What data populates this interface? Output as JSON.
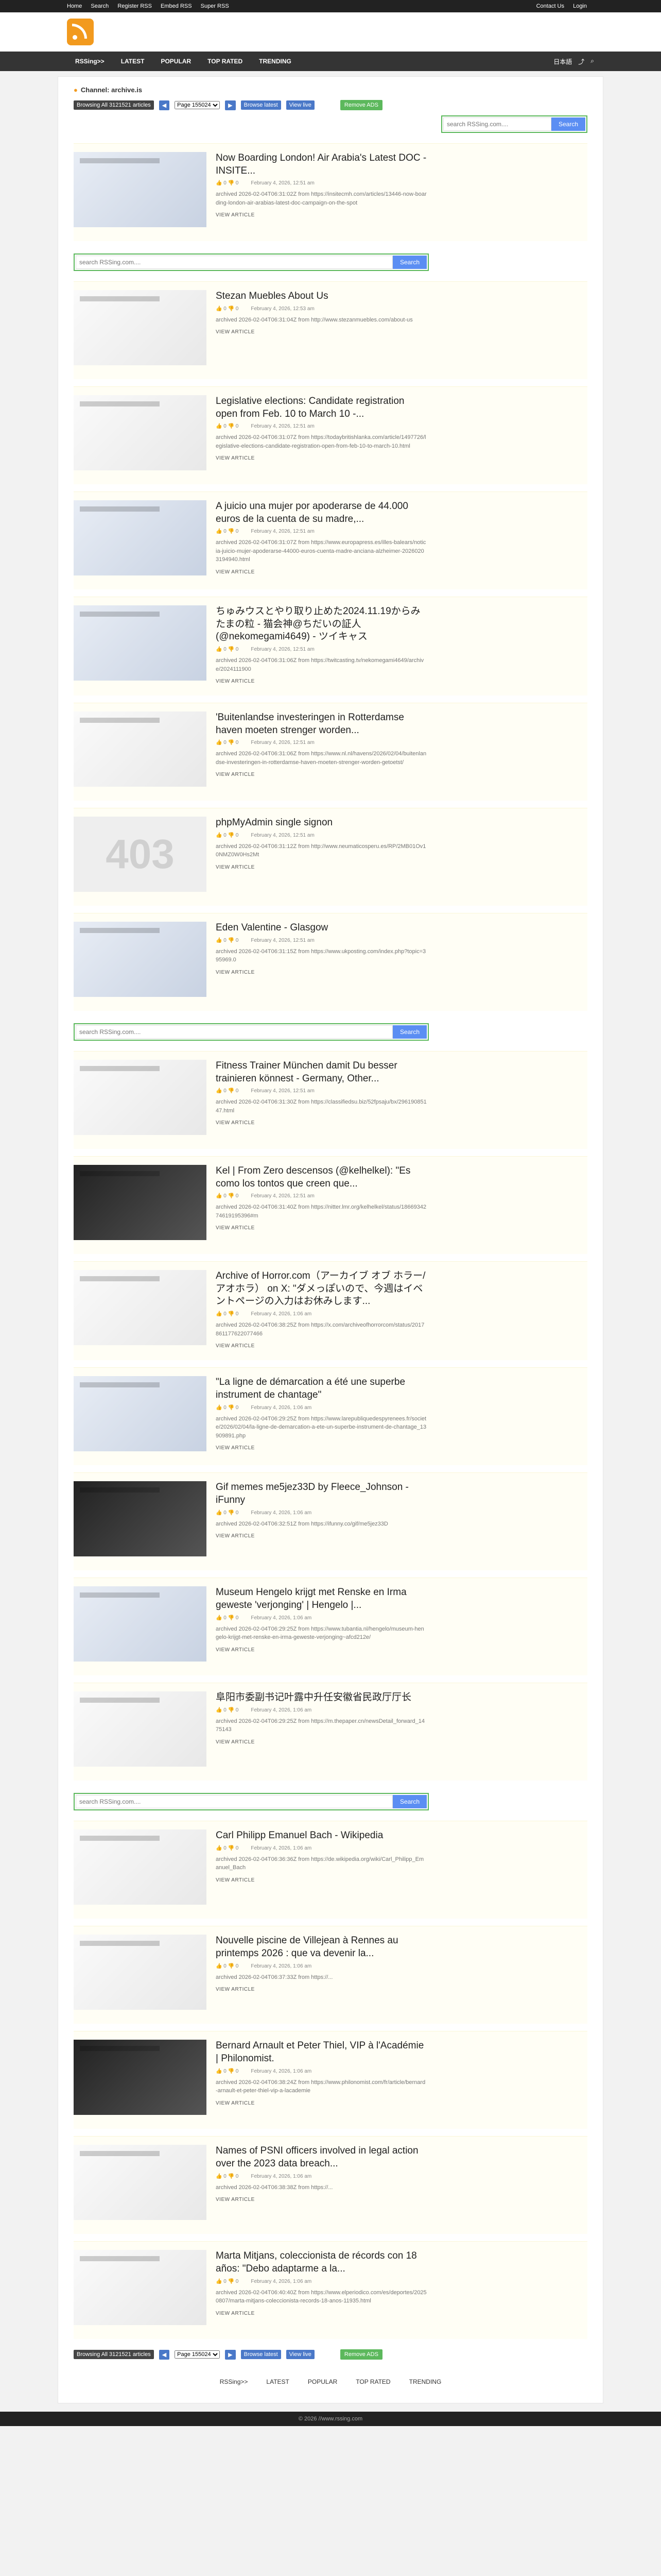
{
  "topbar": {
    "left": [
      "Home",
      "Search",
      "Register RSS",
      "Embed RSS",
      "Super RSS"
    ],
    "right": [
      "Contact Us",
      "Login"
    ]
  },
  "nav": {
    "items": [
      "RSSing>>",
      "LATEST",
      "POPULAR",
      "TOP RATED",
      "TRENDING"
    ],
    "lang": "日本語"
  },
  "channel": {
    "label": "Channel: archive.is"
  },
  "pager": {
    "browsing": "Browsing All 3121521 articles",
    "page_label": "Page 155024",
    "browse_latest": "Browse latest",
    "view_live": "View live",
    "remove_ads": "Remove ADS"
  },
  "search": {
    "placeholder": "search RSSing.com....",
    "button": "Search"
  },
  "view_label": "VIEW ARTICLE",
  "articles": [
    {
      "title": "Now Boarding London! Air Arabia's Latest DOC - INSITE...",
      "date": "February 4, 2026, 12:51 am",
      "archived": "archived 2026-02-04T06:31:02Z from https://insitecmh.com/articles/13446-now-boarding-london-air-arabias-latest-doc-campaign-on-the-spot"
    },
    {
      "title": "Stezan Muebles About Us",
      "date": "February 4, 2026, 12:53 am",
      "archived": "archived 2026-02-04T06:31:04Z from http://www.stezanmuebles.com/about-us"
    },
    {
      "title": "Legislative elections: Candidate registration open from Feb. 10 to March 10 -...",
      "date": "February 4, 2026, 12:51 am",
      "archived": "archived 2026-02-04T06:31:07Z from https://todaybritishlanka.com/article/1497726/legislative-elections-candidate-registration-open-from-feb-10-to-march-10.html"
    },
    {
      "title": "A juicio una mujer por apoderarse de 44.000 euros de la cuenta de su madre,...",
      "date": "February 4, 2026, 12:51 am",
      "archived": "archived 2026-02-04T06:31:07Z from https://www.europapress.es/illes-balears/noticia-juicio-mujer-apoderarse-44000-euros-cuenta-madre-anciana-alzheimer-20260203194940.html"
    },
    {
      "title": "ちゅみウスとやり取り止めた2024.11.19からみたまの粒 - 猫会神@ちだいの証人 (@nekomegami4649) - ツイキャス",
      "date": "February 4, 2026, 12:51 am",
      "archived": "archived 2026-02-04T06:31:06Z from https://twitcasting.tv/nekomegami4649/archive/2024111900"
    },
    {
      "title": "'Buitenlandse investeringen in Rotterdamse haven moeten strenger worden...",
      "date": "February 4, 2026, 12:51 am",
      "archived": "archived 2026-02-04T06:31:06Z from https://www.nl.nl/havens/2026/02/04/buitenlandse-investeringen-in-rotterdamse-haven-moeten-strenger-worden-getoetst/"
    },
    {
      "title": "phpMyAdmin single signon",
      "date": "February 4, 2026, 12:51 am",
      "archived": "archived 2026-02-04T06:31:12Z from http://www.neumaticosperu.es/RP/2MB01Ov10NMZ0W0Hs2Mt"
    },
    {
      "title": "Eden Valentine - Glasgow",
      "date": "February 4, 2026, 12:51 am",
      "archived": "archived 2026-02-04T06:31:15Z from https://www.ukposting.com/index.php?topic=395969.0"
    },
    {
      "title": "Fitness Trainer München damit Du besser trainieren könnest - Germany, Other...",
      "date": "February 4, 2026, 12:51 am",
      "archived": "archived 2026-02-04T06:31:30Z from https://classifiedsu.biz/52fpsaju/bx/29619085147.html"
    },
    {
      "title": "Kel | From Zero descensos (@kelhelkel): \"Es como los tontos que creen que...",
      "date": "February 4, 2026, 12:51 am",
      "archived": "archived 2026-02-04T06:31:40Z from https://nitter.lmr.org/kelhelkel/status/1866934274619195396#m"
    },
    {
      "title": "Archive of Horror.com（アーカイブ オブ ホラー/アオホラ） on X: \"ダメっぽいので、今週はイベントページの入力はお休みします...",
      "date": "February 4, 2026, 1:06 am",
      "archived": "archived 2026-02-04T06:38:25Z from https://x.com/archiveofhorrorcom/status/2017861177622077466"
    },
    {
      "title": "\"La ligne de démarcation a été une superbe instrument de chantage\"",
      "date": "February 4, 2026, 1:06 am",
      "archived": "archived 2026-02-04T06:29:25Z from https://www.larepubliquedespyrenees.fr/societe/2026/02/04/la-ligne-de-demarcation-a-ete-un-superbe-instrument-de-chantage_13909891.php"
    },
    {
      "title": "Gif memes me5jez33D by Fleece_Johnson - iFunny",
      "date": "February 4, 2026, 1:06 am",
      "archived": "archived 2026-02-04T06:32:51Z from https://ifunny.co/gif/me5jez33D"
    },
    {
      "title": "Museum Hengelo krijgt met Renske en Irma geweste 'verjonging' | Hengelo |...",
      "date": "February 4, 2026, 1:06 am",
      "archived": "archived 2026-02-04T06:29:25Z from https://www.tubantia.nl/hengelo/museum-hengelo-krijgt-met-renske-en-irma-geweste-verjonging~afcd212e/"
    },
    {
      "title": "阜阳市委副书记叶露中升任安徽省民政厅厅长",
      "date": "February 4, 2026, 1:06 am",
      "archived": "archived 2026-02-04T06:29:25Z from https://m.thepaper.cn/newsDetail_forward_1475143"
    },
    {
      "title": "Carl Philipp Emanuel Bach - Wikipedia",
      "date": "February 4, 2026, 1:06 am",
      "archived": "archived 2026-02-04T06:36:36Z from https://de.wikipedia.org/wiki/Carl_Philipp_Emanuel_Bach"
    },
    {
      "title": "Nouvelle piscine de Villejean à Rennes au printemps 2026 : que va devenir la...",
      "date": "February 4, 2026, 1:06 am",
      "archived": "archived 2026-02-04T06:37:33Z from https://..."
    },
    {
      "title": "Bernard Arnault et Peter Thiel, VIP à l'Académie | Philonomist.",
      "date": "February 4, 2026, 1:06 am",
      "archived": "archived 2026-02-04T06:38:24Z from https://www.philonomist.com/fr/article/bernard-arnault-et-peter-thiel-vip-a-lacademie"
    },
    {
      "title": "Names of PSNI officers involved in legal action over the 2023 data breach...",
      "date": "February 4, 2026, 1:06 am",
      "archived": "archived 2026-02-04T06:38:38Z from https://..."
    },
    {
      "title": "Marta Mitjans, coleccionista de récords con 18 años: \"Debo adaptarme a la...",
      "date": "February 4, 2026, 1:06 am",
      "archived": "archived 2026-02-04T06:40:40Z from https://www.elperiodico.com/es/deportes/20250807/marta-mitjans-coleccionista-records-18-anos-11935.html"
    }
  ],
  "footer": {
    "nav": [
      "RSSing>>",
      "LATEST",
      "POPULAR",
      "TOP RATED",
      "TRENDING"
    ],
    "copyright": "© 2026 //www.rssing.com"
  }
}
